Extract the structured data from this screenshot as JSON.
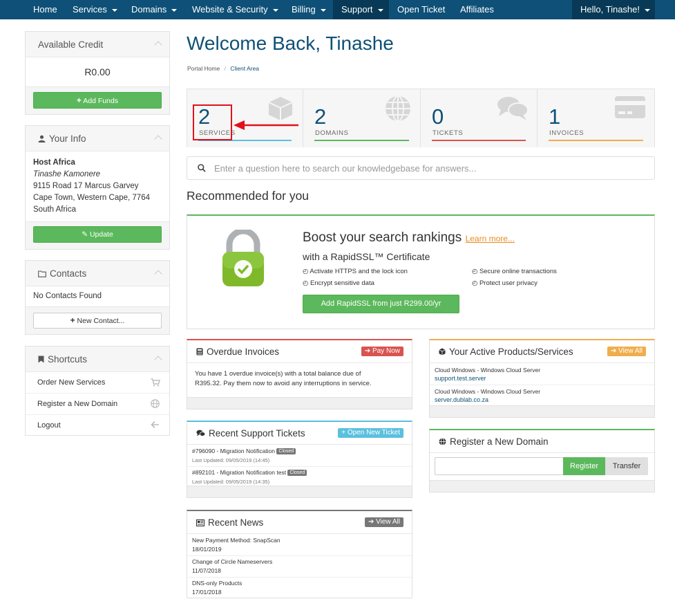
{
  "nav": {
    "items": [
      {
        "label": "Home",
        "caret": false
      },
      {
        "label": "Services",
        "caret": true
      },
      {
        "label": "Domains",
        "caret": true
      },
      {
        "label": "Website & Security",
        "caret": true
      },
      {
        "label": "Billing",
        "caret": true
      },
      {
        "label": "Support",
        "caret": true
      },
      {
        "label": "Open Ticket",
        "caret": false
      },
      {
        "label": "Affiliates",
        "caret": false
      }
    ],
    "user": "Hello, Tinashe!"
  },
  "sidebar": {
    "credit": {
      "title": "Available Credit",
      "amount": "R0.00",
      "button": "Add Funds"
    },
    "info": {
      "title": "Your Info",
      "company": "Host Africa",
      "name": "Tinashe Kamonere",
      "address1": "9115 Road 17 Marcus Garvey",
      "address2": "Cape Town, Western Cape, 7764",
      "country": "South Africa",
      "button": "Update"
    },
    "contacts": {
      "title": "Contacts",
      "empty": "No Contacts Found",
      "button": "New Contact..."
    },
    "shortcuts": {
      "title": "Shortcuts",
      "items": [
        "Order New Services",
        "Register a New Domain",
        "Logout"
      ]
    }
  },
  "main": {
    "title": "Welcome Back, Tinashe",
    "breadcrumb": {
      "home": "Portal Home",
      "sep": "/",
      "current": "Client Area"
    },
    "stats": [
      {
        "num": "2",
        "label": "SERVICES",
        "color": "#5bc0de"
      },
      {
        "num": "2",
        "label": "DOMAINS",
        "color": "#5cb85c"
      },
      {
        "num": "0",
        "label": "TICKETS",
        "color": "#d9534f"
      },
      {
        "num": "1",
        "label": "INVOICES",
        "color": "#f0ad4e"
      }
    ],
    "search_placeholder": "Enter a question here to search our knowledgebase for answers...",
    "recommended": "Recommended for you",
    "promo": {
      "title": "Boost your search rankings",
      "learn_more": "Learn more...",
      "subtitle": "with a RapidSSL™ Certificate",
      "features": [
        "Activate HTTPS and the lock icon",
        "Secure online transactions",
        "Encrypt sensitive data",
        "Protect user privacy"
      ],
      "button": "Add RapidSSL from just R299.00/yr"
    },
    "overdue": {
      "title": "Overdue Invoices",
      "badge": "Pay Now",
      "text1": "You have 1 overdue invoice(s) with a total balance due of",
      "text2": "R395.32. Pay them now to avoid any interruptions in service."
    },
    "products": {
      "title": "Your Active Products/Services",
      "badge": "View All",
      "items": [
        {
          "name": "Cloud Windows - Windows Cloud Server",
          "domain": "support.test.server"
        },
        {
          "name": "Cloud Windows - Windows Cloud Server",
          "domain": "server.dublab.co.za"
        }
      ]
    },
    "tickets": {
      "title": "Recent Support Tickets",
      "badge": "Open New Ticket",
      "items": [
        {
          "subject": "#796090 - Migration Notification",
          "status": "Closed",
          "updated": "Last Updated: 09/05/2019 (14:45)"
        },
        {
          "subject": "#892101 - Migration Notification test",
          "status": "Closed",
          "updated": "Last Updated: 09/05/2019 (14:35)"
        }
      ]
    },
    "register": {
      "title": "Register a New Domain",
      "register_btn": "Register",
      "transfer_btn": "Transfer"
    },
    "news": {
      "title": "Recent News",
      "badge": "View All",
      "items": [
        {
          "title": "New Payment Method: SnapScan",
          "date": "18/01/2019"
        },
        {
          "title": "Change of Circle Nameservers",
          "date": "11/07/2018"
        },
        {
          "title": "DNS-only Products",
          "date": "17/01/2018"
        }
      ]
    }
  },
  "colors": {
    "brand": "#0e5077",
    "green": "#5cb85c",
    "red": "#d9534f",
    "info": "#5bc0de",
    "warning": "#f0ad4e",
    "annotation": "#e3101b"
  }
}
